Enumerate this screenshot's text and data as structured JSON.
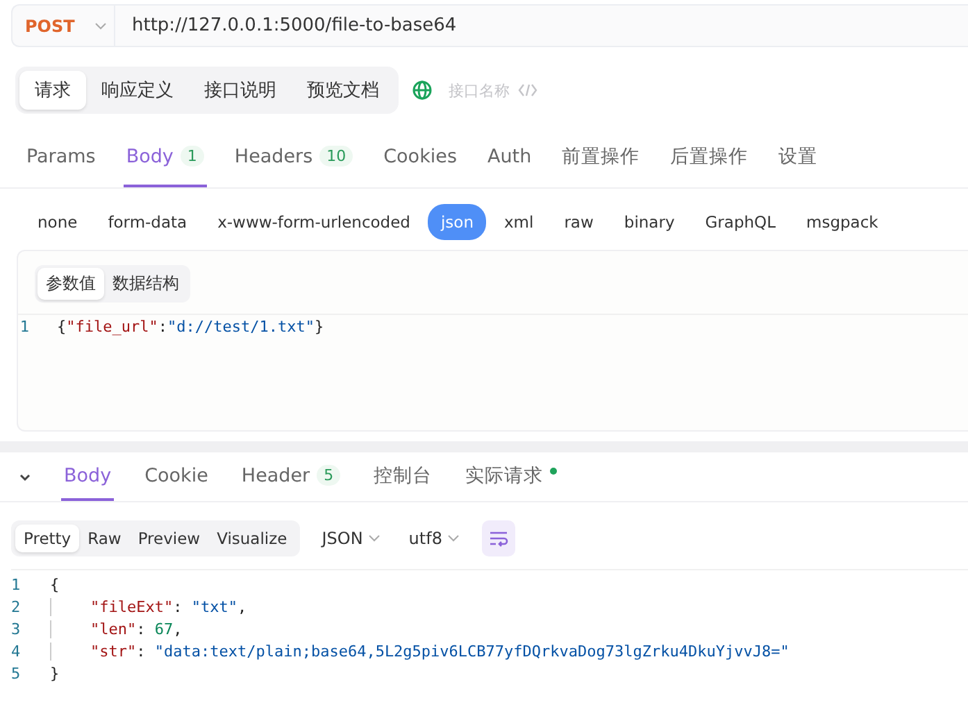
{
  "url_bar": {
    "method": "POST",
    "url": "http://127.0.0.1:5000/file-to-base64"
  },
  "mode_tabs": [
    {
      "label": "请求",
      "selected": true
    },
    {
      "label": "响应定义",
      "selected": false
    },
    {
      "label": "接口说明",
      "selected": false
    },
    {
      "label": "预览文档",
      "selected": false
    }
  ],
  "api_name": {
    "placeholder": "接口名称"
  },
  "request_tabs": [
    {
      "label": "Params",
      "selected": false
    },
    {
      "label": "Body",
      "count": "1",
      "selected": true
    },
    {
      "label": "Headers",
      "count": "10",
      "selected": false
    },
    {
      "label": "Cookies",
      "selected": false
    },
    {
      "label": "Auth",
      "selected": false
    },
    {
      "label": "前置操作",
      "selected": false
    },
    {
      "label": "后置操作",
      "selected": false
    },
    {
      "label": "设置",
      "selected": false
    }
  ],
  "body_types": [
    {
      "label": "none",
      "selected": false
    },
    {
      "label": "form-data",
      "selected": false
    },
    {
      "label": "x-www-form-urlencoded",
      "selected": false
    },
    {
      "label": "json",
      "selected": true
    },
    {
      "label": "xml",
      "selected": false
    },
    {
      "label": "raw",
      "selected": false
    },
    {
      "label": "binary",
      "selected": false
    },
    {
      "label": "GraphQL",
      "selected": false
    },
    {
      "label": "msgpack",
      "selected": false
    }
  ],
  "editor_tabs": [
    {
      "label": "参数值",
      "selected": true
    },
    {
      "label": "数据结构",
      "selected": false
    }
  ],
  "request_code": [
    {
      "number": "1",
      "indented": false,
      "tokens": [
        {
          "kind": "punct",
          "text": "{"
        },
        {
          "kind": "key",
          "text": "\"file_url\""
        },
        {
          "kind": "punct",
          "text": ":"
        },
        {
          "kind": "string",
          "text": "\"d://test/1.txt\""
        },
        {
          "kind": "punct",
          "text": "}"
        }
      ]
    }
  ],
  "response_tabs": [
    {
      "label": "Body",
      "selected": true
    },
    {
      "label": "Cookie",
      "selected": false
    },
    {
      "label": "Header",
      "count": "5",
      "selected": false
    },
    {
      "label": "控制台",
      "selected": false
    },
    {
      "label": "实际请求",
      "dot": true,
      "selected": false
    }
  ],
  "view_modes": [
    {
      "label": "Pretty",
      "selected": true
    },
    {
      "label": "Raw",
      "selected": false
    },
    {
      "label": "Preview",
      "selected": false
    },
    {
      "label": "Visualize",
      "selected": false
    }
  ],
  "format_select": "JSON",
  "encoding_select": "utf8",
  "response_code": [
    {
      "number": "1",
      "indented": false,
      "tokens": [
        {
          "kind": "punct",
          "text": "{"
        }
      ]
    },
    {
      "number": "2",
      "indented": true,
      "tokens": [
        {
          "kind": "key",
          "text": "\"fileExt\""
        },
        {
          "kind": "punct",
          "text": ": "
        },
        {
          "kind": "string",
          "text": "\"txt\""
        },
        {
          "kind": "punct",
          "text": ","
        }
      ]
    },
    {
      "number": "3",
      "indented": true,
      "tokens": [
        {
          "kind": "key",
          "text": "\"len\""
        },
        {
          "kind": "punct",
          "text": ": "
        },
        {
          "kind": "number",
          "text": "67"
        },
        {
          "kind": "punct",
          "text": ","
        }
      ]
    },
    {
      "number": "4",
      "indented": true,
      "tokens": [
        {
          "kind": "key",
          "text": "\"str\""
        },
        {
          "kind": "punct",
          "text": ": "
        },
        {
          "kind": "string",
          "text": "\"data:text/plain;base64,5L2g5piv6LCB77yfDQrkvaDog73lgZrku4DkuYjvvJ8=\""
        }
      ]
    },
    {
      "number": "5",
      "indented": false,
      "tokens": [
        {
          "kind": "punct",
          "text": "}"
        }
      ]
    }
  ]
}
